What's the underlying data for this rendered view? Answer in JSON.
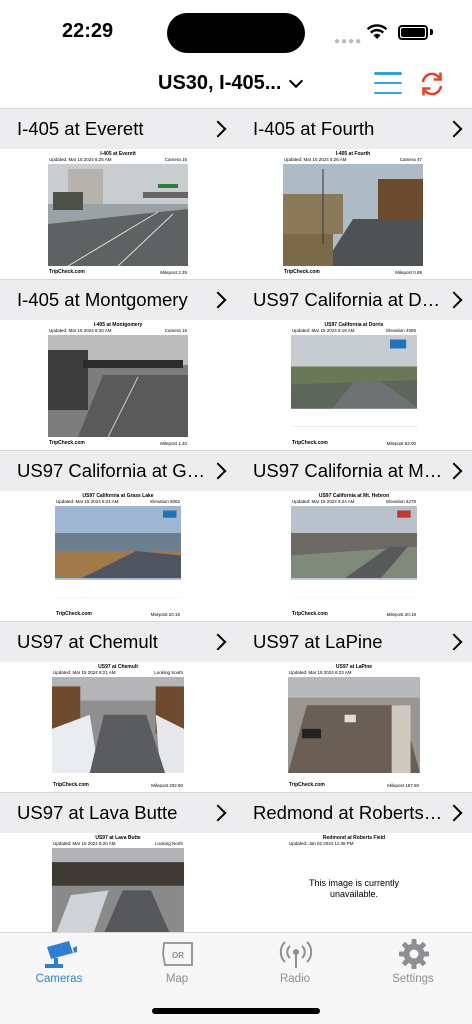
{
  "status": {
    "time": "22:29"
  },
  "nav": {
    "title": "US30, I-405...",
    "menu_icon": "hamburger-menu-icon",
    "refresh_icon": "refresh-icon"
  },
  "colors": {
    "accent_blue": "#2f7fd1",
    "menu_blue": "#3aa3dc",
    "refresh_red": "#e8442b",
    "header_gray": "#ededef"
  },
  "cameras": [
    {
      "title": "I-405 at Everett",
      "cam_name": "I-405 at Everett",
      "updated": "Updated: Mar 15 2024  8:25 AM",
      "extra": "Camera 15",
      "brand": "TripCheck.com",
      "milepost": "Milepost 2.35"
    },
    {
      "title": "I-405 at Fourth",
      "cam_name": "I-405 at Fourth",
      "updated": "Updated: Mar 15 2024  8:26 AM",
      "extra": "Camera 47",
      "brand": "TripCheck.com",
      "milepost": "Milepost 0.89"
    },
    {
      "title": "I-405 at Montgomery",
      "cam_name": "I-405 at Montgomery",
      "updated": "Updated: Mar 15 2024  8:20 AM",
      "extra": "Camera 16",
      "brand": "TripCheck.com",
      "milepost": "Milepost 1.40"
    },
    {
      "title": "US97 California at Dorris",
      "cam_name": "US97 California at Dorris",
      "updated": "Updated: Mar 15 2024  8:18 AM",
      "extra": "Elevation 4095",
      "brand": "TripCheck.com",
      "milepost": "Milepost 52.00"
    },
    {
      "title": "US97 California at Grass Lake",
      "cam_name": "US97 California at Grass Lake",
      "updated": "Updated: Mar 15 2024  8:21 AM",
      "extra": "Elevation 5062",
      "brand": "TripCheck.com",
      "milepost": "Milepost 20.19"
    },
    {
      "title": "US97 California  at Mt. Hebron",
      "cam_name": "US97 California  at Mt. Hebron",
      "updated": "Updated: Mar 15 2024  8:24 AM",
      "extra": "Elevation 4278",
      "brand": "TripCheck.com",
      "milepost": "Milepost 20.19"
    },
    {
      "title": "US97 at Chemult",
      "cam_name": "US97 at Chemult",
      "updated": "Updated: Mar 15 2024  8:21 AM",
      "extra": "Looking South",
      "brand": "TripCheck.com",
      "milepost": "Milepost 202.90"
    },
    {
      "title": "US97 at LaPine",
      "cam_name": "US97 at LaPine",
      "updated": "Updated: Mar 15 2024  8:23 AM",
      "extra": "",
      "brand": "TripCheck.com",
      "milepost": "Milepost 167.50"
    },
    {
      "title": "US97 at Lava Butte",
      "cam_name": "US97 at Lava Butte",
      "updated": "Updated: Mar 15 2024  8:20 AM",
      "extra": "Looking North",
      "brand": "",
      "milepost": ""
    },
    {
      "title": "Redmond at Roberts Field",
      "cam_name": "Redmond at Roberts Field",
      "updated": "Updated: Jan 02 2024  11:36 PM",
      "extra": "",
      "brand": "",
      "milepost": "",
      "unavailable": "This image is currently unavailable."
    }
  ],
  "tabs": [
    {
      "label": "Cameras",
      "icon": "camera-icon",
      "active": true
    },
    {
      "label": "Map",
      "icon": "oregon-map-icon",
      "badge": "OR"
    },
    {
      "label": "Radio",
      "icon": "radio-antenna-icon"
    },
    {
      "label": "Settings",
      "icon": "gear-icon"
    }
  ]
}
